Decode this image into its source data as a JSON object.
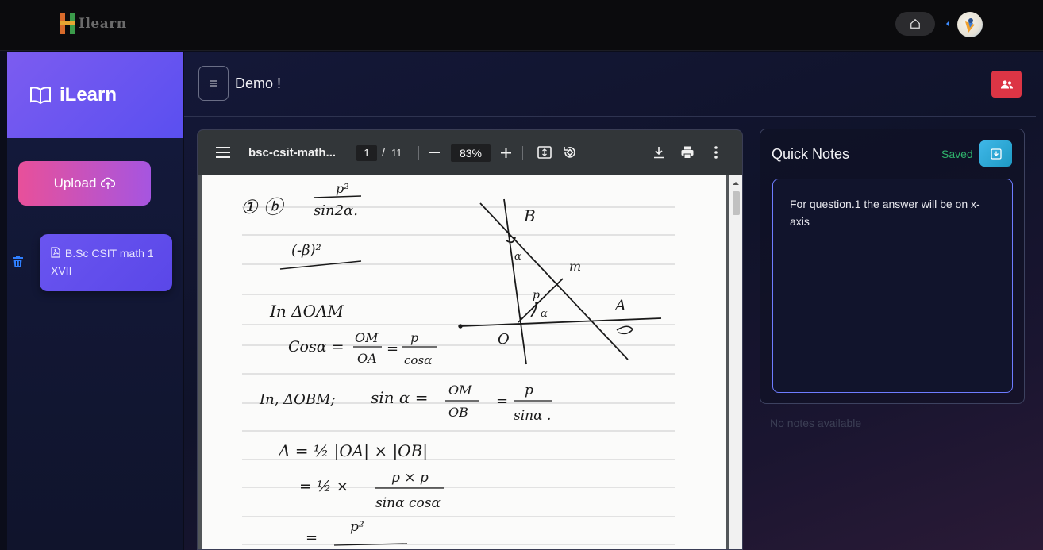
{
  "topbar": {
    "brand_text": "Ilearn",
    "home_icon": "home-icon",
    "caret_icon": "caret-left-icon",
    "avatar_icon": "bird-avatar"
  },
  "sidebar": {
    "title": "iLearn",
    "title_icon": "book-open-icon",
    "upload_label": "Upload",
    "upload_icon": "cloud-upload-icon",
    "files": [
      {
        "label": "B.Sc CSIT math 1 XVII",
        "icon": "pdf-file-icon"
      }
    ]
  },
  "header": {
    "title": "Demo !",
    "menu_icon": "hamburger-icon",
    "people_icon": "users-icon",
    "people_color": "#dc3545"
  },
  "pdf": {
    "file_name": "bsc-csit-math...",
    "current_page": "1",
    "separator": "/",
    "total_pages": "11",
    "zoom": "83%",
    "handwriting": {
      "l1": "① ⓑ",
      "l1b": "p²",
      "l1c": "sin2α.",
      "l2": "(-β)²",
      "l3": "In ΔOAM",
      "l4a": "Cosα =",
      "l4b": "OM",
      "l4c": "OA",
      "l4d": "=",
      "l4e": "p",
      "l4f": "cosα",
      "l5a": "In, ΔOBM;",
      "l5b": "sin α =",
      "l5c": "OM",
      "l5d": "OB",
      "l5e": "=",
      "l5f": "p",
      "l5g": "sinα .",
      "l6": "Δ = ½ |OA| × |OB|",
      "l7a": "= ½ ×",
      "l7b": "p × p",
      "l7c": "sinα cosα",
      "l8a": "=",
      "l8b": "p²",
      "d_b": "B",
      "d_m": "m",
      "d_p": "p",
      "d_a": "A",
      "d_o": "O",
      "d_alpha1": "α",
      "d_alpha2": "α"
    }
  },
  "notes": {
    "title": "Quick Notes",
    "status": "Saved",
    "status_color": "#2fb36c",
    "save_icon": "save-download-icon",
    "content": "For question.1 the answer will be on x-axis",
    "empty_text": "No notes available"
  }
}
